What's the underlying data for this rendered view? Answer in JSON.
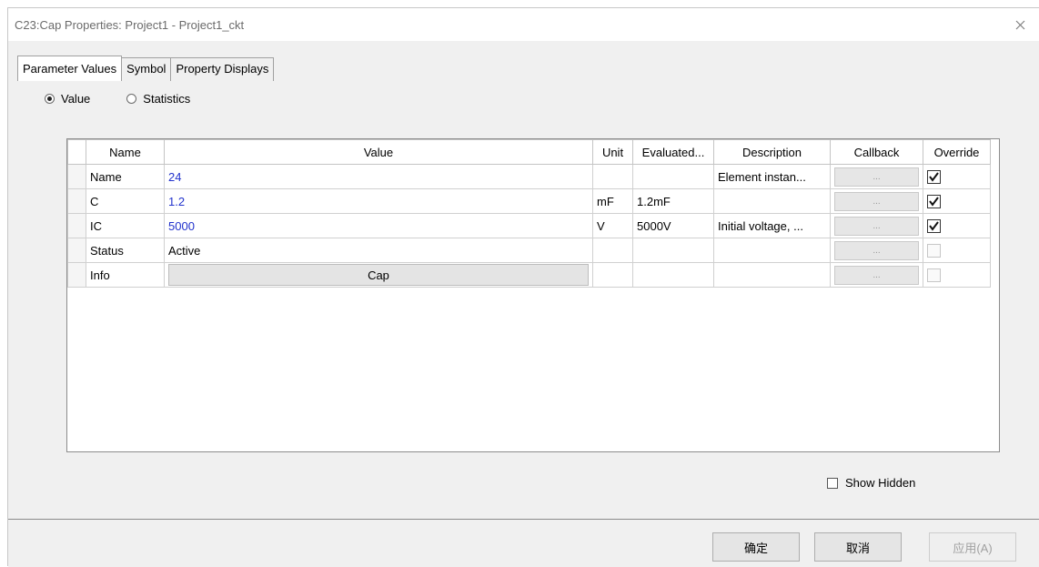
{
  "window": {
    "title": "C23:Cap Properties: Project1 - Project1_ckt",
    "close_icon": "close-icon"
  },
  "tabs": [
    {
      "label": "Parameter Values",
      "active": true
    },
    {
      "label": "Symbol",
      "active": false
    },
    {
      "label": "Property Displays",
      "active": false
    }
  ],
  "mode": {
    "options": [
      {
        "label": "Value",
        "selected": true
      },
      {
        "label": "Statistics",
        "selected": false
      }
    ]
  },
  "grid": {
    "columns": [
      "Name",
      "Value",
      "Unit",
      "Evaluated...",
      "Description",
      "Callback",
      "Override"
    ],
    "rows": [
      {
        "name": "Name",
        "value": "24",
        "value_color": "blue",
        "unit": "",
        "evaluated": "",
        "description": "Element instan...",
        "callback": "...",
        "override": true,
        "override_enabled": true
      },
      {
        "name": "C",
        "value": "1.2",
        "value_color": "blue",
        "unit": "mF",
        "evaluated": "1.2mF",
        "description": "",
        "callback": "...",
        "override": true,
        "override_enabled": true
      },
      {
        "name": "IC",
        "value": "5000",
        "value_color": "blue",
        "unit": "V",
        "evaluated": "5000V",
        "description": "Initial voltage, ...",
        "callback": "...",
        "override": true,
        "override_enabled": true
      },
      {
        "name": "Status",
        "value": "Active",
        "value_color": "black",
        "unit": "",
        "evaluated": "",
        "description": "",
        "callback": "...",
        "override": false,
        "override_enabled": false
      },
      {
        "name": "Info",
        "value": "Cap",
        "value_is_button": true,
        "unit": "",
        "evaluated": "",
        "description": "",
        "callback": "...",
        "override": false,
        "override_enabled": false
      }
    ]
  },
  "show_hidden": {
    "label": "Show Hidden",
    "checked": false
  },
  "buttons": {
    "ok": "确定",
    "cancel": "取消",
    "apply": "应用(A)"
  },
  "colors": {
    "value_blue": "#2233cc",
    "dialog_bg": "#f0f0f0"
  }
}
